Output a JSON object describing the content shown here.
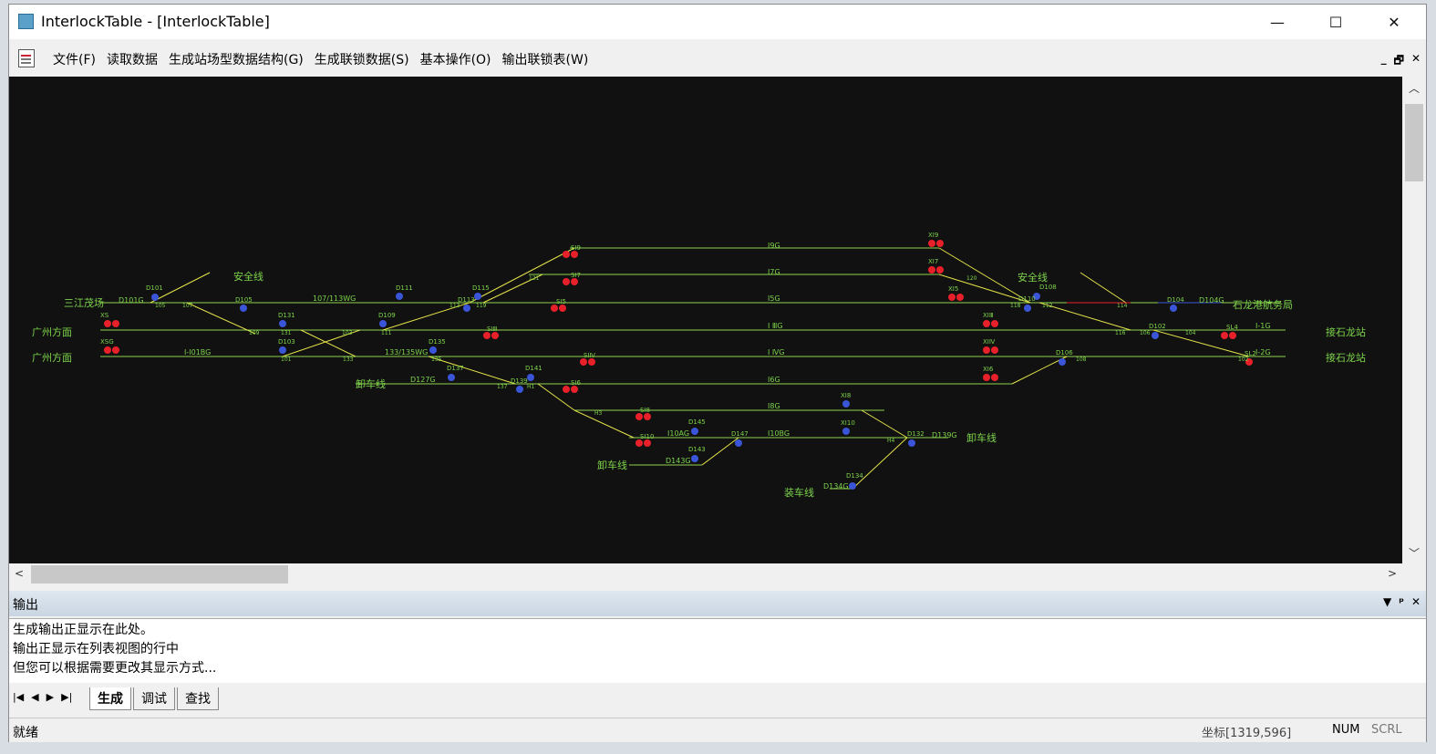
{
  "window": {
    "title": "InterlockTable - [InterlockTable]",
    "minimize": "—",
    "maximize": "☐",
    "close": "✕"
  },
  "menu": {
    "items": [
      "文件(F)",
      "读取数据",
      "生成站场型数据结构(G)",
      "生成联锁数据(S)",
      "基本操作(O)",
      "输出联锁表(W)"
    ],
    "mdi": [
      "_",
      "🗗",
      "✕"
    ]
  },
  "diagram": {
    "track_labels": [
      "Ⅰ9G",
      "Ⅰ7G",
      "Ⅰ5G",
      "Ⅰ ⅢG",
      "Ⅰ ⅣG",
      "Ⅰ6G",
      "Ⅰ8G",
      "Ⅰ10BG",
      "Ⅰ10AG",
      "Ⅰ-Ⅰ01BG",
      "107/113WG",
      "133/135WG",
      "D127G",
      "D101G",
      "D104G",
      "D143G",
      "D139G",
      "D134G",
      "Ⅰ-1G",
      "Ⅰ-2G"
    ],
    "station_labels": [
      "三江茂场",
      "广州方面",
      "广州方面",
      "安全线",
      "安全线",
      "卸车线",
      "卸车线",
      "卸车线",
      "装车线",
      "石龙港航务局",
      "接石龙站",
      "接石龙站"
    ],
    "signal_labels": [
      "SⅠ9",
      "SⅠ7",
      "SⅠ5",
      "SⅠⅢ",
      "SⅠⅣ",
      "SⅠ6",
      "SⅠ8",
      "SⅠ10",
      "XⅠ9",
      "XⅠ7",
      "XⅠ5",
      "XⅠⅢ",
      "XⅠⅣ",
      "XⅠ6",
      "XⅠ8",
      "XⅠ10",
      "XS",
      "XSG",
      "SL4",
      "SL2"
    ],
    "d_labels": [
      "D101",
      "D105",
      "D111",
      "D115",
      "D131",
      "D103",
      "D109",
      "D113",
      "D135",
      "D137",
      "D141",
      "D139",
      "D145",
      "D147",
      "D143",
      "D132",
      "D134",
      "D108",
      "D110",
      "D102",
      "D106",
      "D104"
    ],
    "switch_labels": [
      "105",
      "107",
      "109",
      "131",
      "101",
      "103",
      "133",
      "111",
      "113",
      "119",
      "121",
      "135",
      "137",
      "H1",
      "H3",
      "H4",
      "118",
      "112",
      "114",
      "120",
      "116",
      "106",
      "104",
      "108",
      "102"
    ]
  },
  "output": {
    "title": "输出",
    "lines": [
      "生成输出正显示在此处。",
      "输出正显示在列表视图的行中",
      "但您可以根据需要更改其显示方式..."
    ],
    "ctrls": [
      "▼",
      "ᵖ",
      "✕"
    ]
  },
  "tabs": {
    "nav": [
      "|◀",
      "◀",
      "▶",
      "▶|"
    ],
    "items": [
      "生成",
      "调试",
      "查找"
    ]
  },
  "status": {
    "text": "就绪",
    "coord": "坐标[1319,596]",
    "num": "NUM",
    "scrl": "SCRL"
  },
  "colors": {
    "canvas": "#111111",
    "track": "#8fd14f",
    "track_yellow": "#e4e44a",
    "signal_red": "#e8202a",
    "signal_blue": "#3a55d8",
    "label_green": "#7dd44a"
  }
}
